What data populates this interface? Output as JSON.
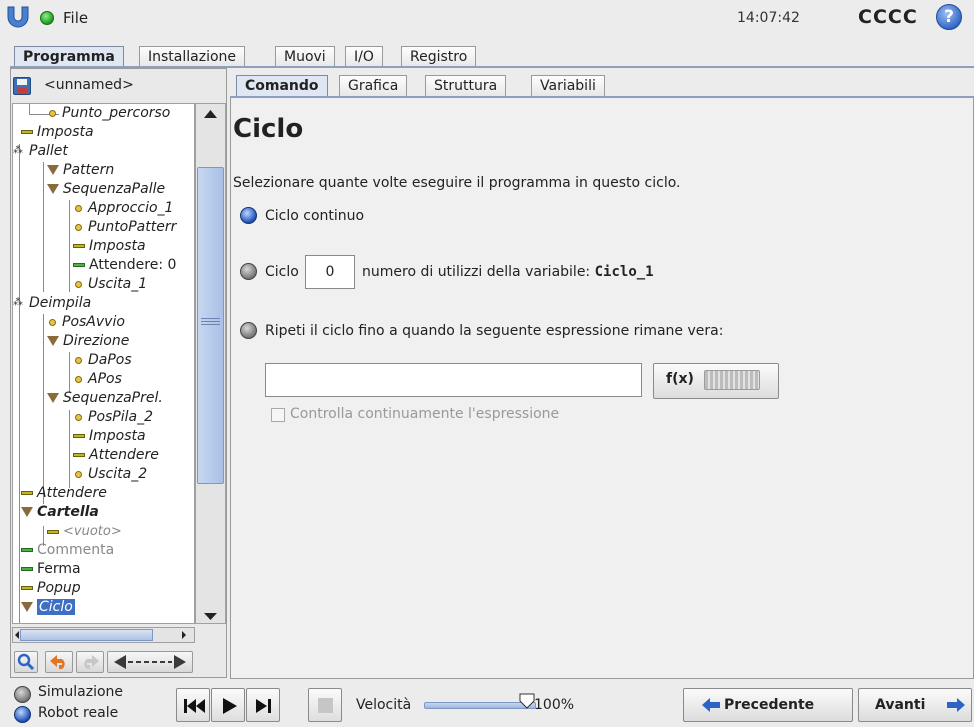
{
  "topbar": {
    "file_label": "File",
    "clock": "14:07:42",
    "robot_name": "CCCC",
    "help_symbol": "?"
  },
  "main_tabs": [
    "Programma",
    "Installazione",
    "Muovi",
    "I/O",
    "Registro"
  ],
  "main_tab_active": "Programma",
  "program": {
    "name": "<unnamed>"
  },
  "tree": [
    {
      "label": "Punto_percorso",
      "icon": "waypoint-dot"
    },
    {
      "label": "Imposta",
      "icon": "set-dash"
    },
    {
      "label": "Pallet",
      "icon": "pallet"
    },
    {
      "label": "Pattern",
      "icon": "folder-triangle"
    },
    {
      "label": "SequenzaPalle",
      "icon": "folder-triangle"
    },
    {
      "label": "Approccio_1",
      "icon": "waypoint-dot"
    },
    {
      "label": "PuntoPatterr",
      "icon": "waypoint-dot"
    },
    {
      "label": "Imposta",
      "icon": "set-dash"
    },
    {
      "label": "Attendere: 0",
      "icon": "wait-dash"
    },
    {
      "label": "Uscita_1",
      "icon": "waypoint-dot"
    },
    {
      "label": "Deimpila",
      "icon": "pallet"
    },
    {
      "label": "PosAvvio",
      "icon": "waypoint-dot"
    },
    {
      "label": "Direzione",
      "icon": "folder-triangle"
    },
    {
      "label": "DaPos",
      "icon": "waypoint-dot"
    },
    {
      "label": "APos",
      "icon": "waypoint-dot"
    },
    {
      "label": "SequenzaPrel.",
      "icon": "folder-triangle"
    },
    {
      "label": "PosPila_2",
      "icon": "waypoint-dot"
    },
    {
      "label": "Imposta",
      "icon": "set-dash"
    },
    {
      "label": "Attendere",
      "icon": "set-dash"
    },
    {
      "label": "Uscita_2",
      "icon": "waypoint-dot"
    },
    {
      "label": "Attendere",
      "icon": "set-dash"
    },
    {
      "label": "Cartella",
      "icon": "folder-triangle"
    },
    {
      "label": "<vuoto>",
      "icon": "set-dash"
    },
    {
      "label": "Commenta",
      "icon": "comment-dash"
    },
    {
      "label": "Ferma",
      "icon": "halt-dash"
    },
    {
      "label": "Popup",
      "icon": "set-dash"
    },
    {
      "label": "Ciclo",
      "icon": "folder-triangle"
    }
  ],
  "tree_tools": {
    "search_icon": "search-icon",
    "undo_icon": "undo-icon",
    "redo_icon": "redo-icon",
    "move_icon": "move-icon"
  },
  "sub_tabs": [
    "Comando",
    "Grafica",
    "Struttura",
    "Variabili"
  ],
  "sub_tab_active": "Comando",
  "command": {
    "title": "Ciclo",
    "description": "Selezionare quante volte eseguire il programma in questo ciclo.",
    "opt_continuous": "Ciclo continuo",
    "opt_count_prefix": "Ciclo",
    "loop_count": "0",
    "opt_count_suffix": "numero di utilizzi della variabile:",
    "variable_name": "Ciclo_1",
    "opt_expression": "Ripeti il ciclo fino a quando la seguente espressione rimane vera:",
    "expression_value": "",
    "fx_label": "f(x)",
    "check_label": "Controlla continuamente l'espressione",
    "selected_option": "continuous"
  },
  "bottom": {
    "sim_label": "Simulazione",
    "real_label": "Robot reale",
    "speed_label": "Velocità",
    "speed_value": "100%",
    "speed_fraction": 1.0,
    "prev_label": "Precedente",
    "next_label": "Avanti"
  },
  "colors": {
    "accent": "#3d6fc4",
    "status_green": "#1e9a1e"
  }
}
